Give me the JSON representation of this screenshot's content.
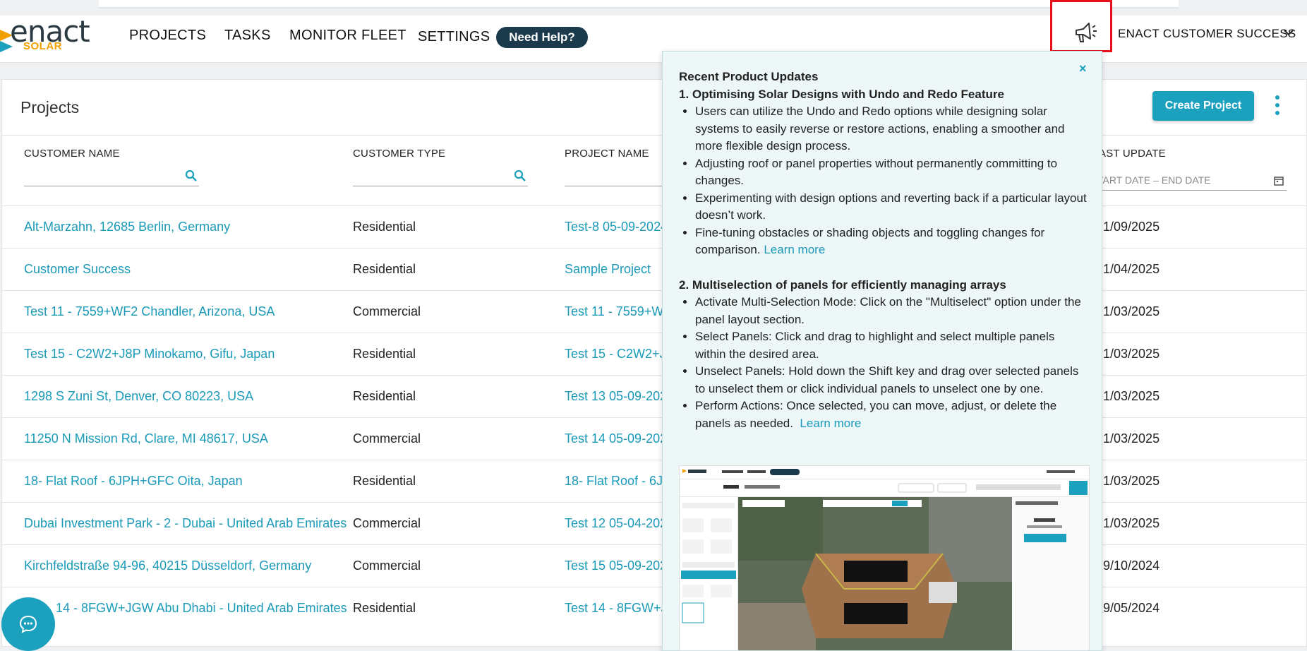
{
  "brand": {
    "name": "enact",
    "sub": "SOLAR"
  },
  "nav": [
    {
      "label": "PROJECTS"
    },
    {
      "label": "TASKS"
    },
    {
      "label": "MONITOR FLEET"
    },
    {
      "label": "SETTINGS"
    }
  ],
  "help_button": "Need Help?",
  "account": {
    "name": "ENACT CUSTOMER SUCCESS"
  },
  "page": {
    "title": "Projects",
    "create_button": "Create Project",
    "columns": {
      "customer_name": "CUSTOMER NAME",
      "customer_type": "CUSTOMER TYPE",
      "project_name": "PROJECT NAME",
      "last_update": "AST UPDATE"
    },
    "date_filter_placeholder": "TART DATE – END DATE"
  },
  "rows": [
    {
      "customer": "Alt-Marzahn, 12685 Berlin, Germany",
      "type": "Residential",
      "project": "Test-8 05-09-2024",
      "date": "1/09/2025"
    },
    {
      "customer": "Customer Success",
      "type": "Residential",
      "project": "Sample Project",
      "date": "1/04/2025"
    },
    {
      "customer": "Test 11 - 7559+WF2 Chandler, Arizona, USA",
      "type": "Commercial",
      "project": "Test 11 - 7559+W",
      "date": "1/03/2025"
    },
    {
      "customer": "Test 15 - C2W2+J8P Minokamo, Gifu, Japan",
      "type": "Residential",
      "project": "Test 15 - C2W2+J",
      "date": "1/03/2025"
    },
    {
      "customer": "1298 S Zuni St, Denver, CO 80223, USA",
      "type": "Residential",
      "project": "Test 13 05-09-202",
      "date": "1/03/2025"
    },
    {
      "customer": "11250 N Mission Rd, Clare, MI 48617, USA",
      "type": "Commercial",
      "project": "Test 14 05-09-202",
      "date": "1/03/2025"
    },
    {
      "customer": "18- Flat Roof - 6JPH+GFC Oita, Japan",
      "type": "Residential",
      "project": "18- Flat Roof - 6J",
      "date": "1/03/2025"
    },
    {
      "customer": "Dubai Investment Park - 2 - Dubai - United Arab Emirates",
      "type": "Commercial",
      "project": "Test 12 05-04-202",
      "date": "1/03/2025"
    },
    {
      "customer": "Kirchfeldstraße 94-96, 40215 Düsseldorf, Germany",
      "type": "Commercial",
      "project": "Test 15 05-09-202",
      "date": "9/10/2024"
    },
    {
      "customer": "14 - 8FGW+JGW Abu Dhabi - United Arab Emirates",
      "type": "Residential",
      "project": "Test 14 - 8FGW+J",
      "date": "9/05/2024"
    }
  ],
  "popup": {
    "close": "×",
    "heading": "Recent Product Updates",
    "section1_title": "1. Optimising Solar Designs with Undo and Redo Feature",
    "section1_items": [
      "Users can utilize the Undo and Redo options while designing solar systems to easily reverse or restore actions, enabling a smoother and more flexible design process.",
      "Adjusting roof or panel properties without permanently committing to changes.",
      "Experimenting with design options and reverting back if a particular layout doesn’t work.",
      "Fine-tuning obstacles or shading objects and toggling changes for comparison."
    ],
    "learn_more_1": "Learn more",
    "section2_title": "2. Multiselection of panels for efficiently managing arrays",
    "section2_items": [
      "Activate Multi-Selection Mode: Click on the \"Multiselect\" option under the panel layout section.",
      "Select Panels: Click and drag to highlight and select multiple panels within the desired area.",
      "Unselect Panels: Hold down the Shift key and drag over selected panels to unselect them or click individual panels to unselect one by one.",
      "Perform Actions: Once selected, you can move, adjust, or delete the panels as needed."
    ],
    "learn_more_2": "Learn more"
  },
  "colors": {
    "accent": "#1ba1bd",
    "link": "#1a9ab8",
    "help_bg": "#1b3a4b",
    "brand_orange": "#f2a000",
    "highlight_red": "#e5121b"
  },
  "icons": {
    "search": "search-icon",
    "announcement": "megaphone-icon",
    "chat": "chat-icon",
    "calendar": "calendar-icon",
    "more": "kebab-icon"
  }
}
